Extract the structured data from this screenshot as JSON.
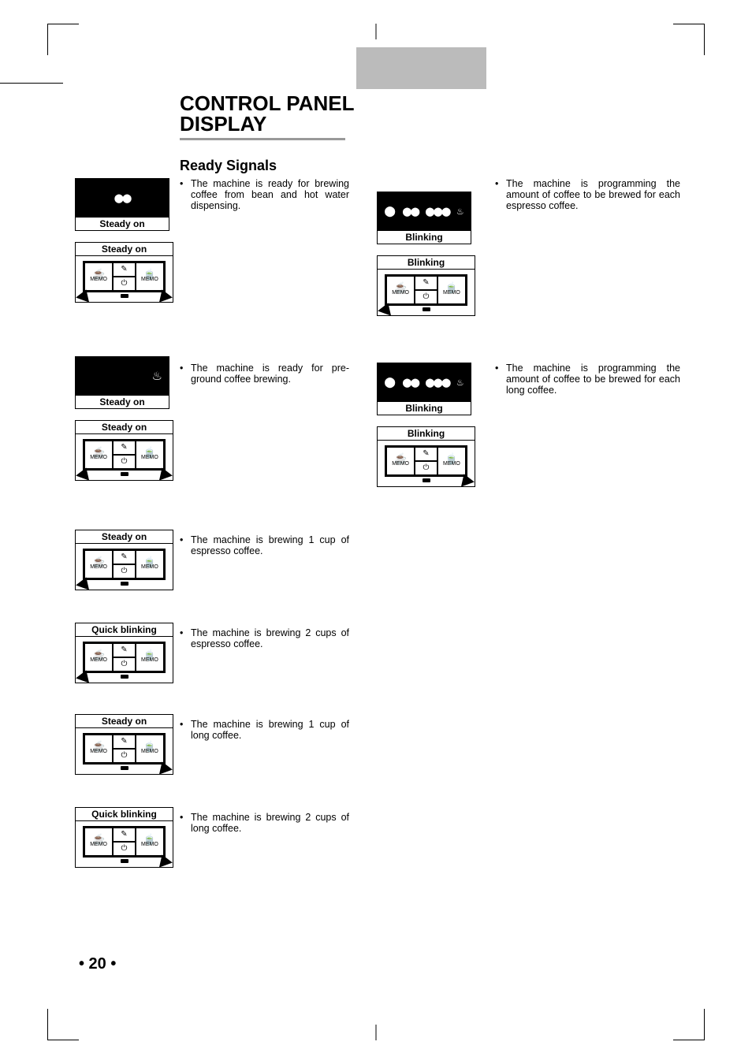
{
  "page_number": "• 20 •",
  "heading_line1": "CONTROL PANEL",
  "heading_line2": "DISPLAY",
  "subheading": "Ready Signals",
  "labels": {
    "steady_on": "Steady on",
    "quick_blinking": "Quick blinking",
    "blinking": "Blinking",
    "memo": "MEMO"
  },
  "left_items": [
    {
      "text": "The machine is ready for brewing coffee from bean and hot water dispensing."
    },
    {
      "text": "The machine is ready for pre-ground coffee brewing."
    },
    {
      "text": "The machine is brewing 1 cup of espresso coffee."
    },
    {
      "text": "The machine is brewing 2 cups of espresso coffee."
    },
    {
      "text": "The machine is brewing 1 cup of long coffee."
    },
    {
      "text": "The machine is brewing 2 cups of long coffee."
    }
  ],
  "right_items": [
    {
      "text": "The machine is programming the amount of coffee to be brewed for each espresso coffee."
    },
    {
      "text": "The machine is programming the amount of coffee to be brewed for each long coffee."
    }
  ]
}
